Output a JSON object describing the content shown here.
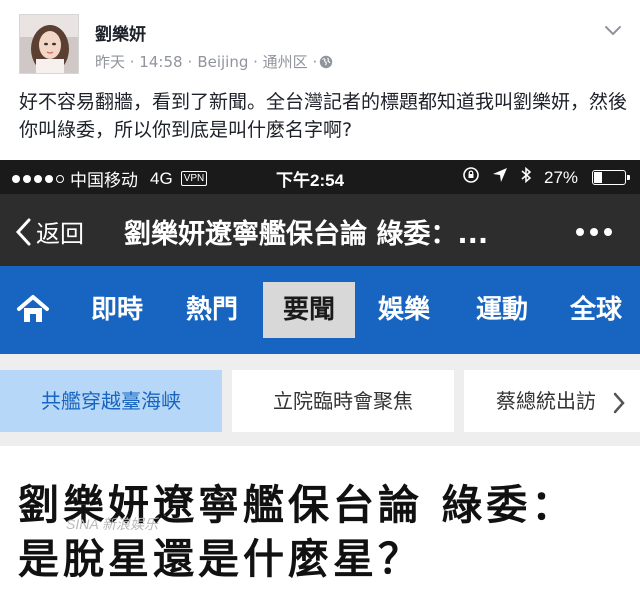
{
  "post": {
    "author": "劉樂妍",
    "time": "昨天 · 14:58",
    "location": "Beijing · 通州区 ·",
    "text": "好不容易翻牆，看到了新聞。全台灣記者的標題都知道我叫劉樂妍，然後你叫綠委，所以你到底是叫什麼名字啊?"
  },
  "statusbar": {
    "carrier": "中国移动",
    "network": "4G",
    "vpn": "VPN",
    "time": "下午2:54",
    "battery": "27%",
    "battery_level": 0.27
  },
  "navbar": {
    "back_label": "返回",
    "title": "劉樂妍遼寧艦保台論 綠委：..."
  },
  "tabs": [
    {
      "label": "即時"
    },
    {
      "label": "熱門"
    },
    {
      "label": "要聞",
      "active": true
    },
    {
      "label": "娛樂"
    },
    {
      "label": "運動"
    },
    {
      "label": "全球"
    }
  ],
  "subtabs": [
    {
      "label": "共艦穿越臺海峡",
      "active": true
    },
    {
      "label": "立院臨時會聚焦"
    },
    {
      "label": "蔡總統出訪"
    }
  ],
  "article": {
    "headline_line1": "劉樂妍遼寧艦保台論 綠委：",
    "headline_line2": "是脫星還是什麼星？"
  },
  "watermark": "SINA 新浪娱乐",
  "colors": {
    "tab_bar": "#1765c0",
    "nav_bar": "#2d2d2d",
    "status_bar": "#1a1a1a",
    "active_chip": "#b6d7f7",
    "meta_text": "#90949c"
  },
  "icons": [
    "chevron-down-icon",
    "globe-icon",
    "back-chevron-icon",
    "more-icon",
    "home-icon",
    "chevron-right-icon",
    "location-icon",
    "bluetooth-icon",
    "lock-rotation-icon"
  ]
}
